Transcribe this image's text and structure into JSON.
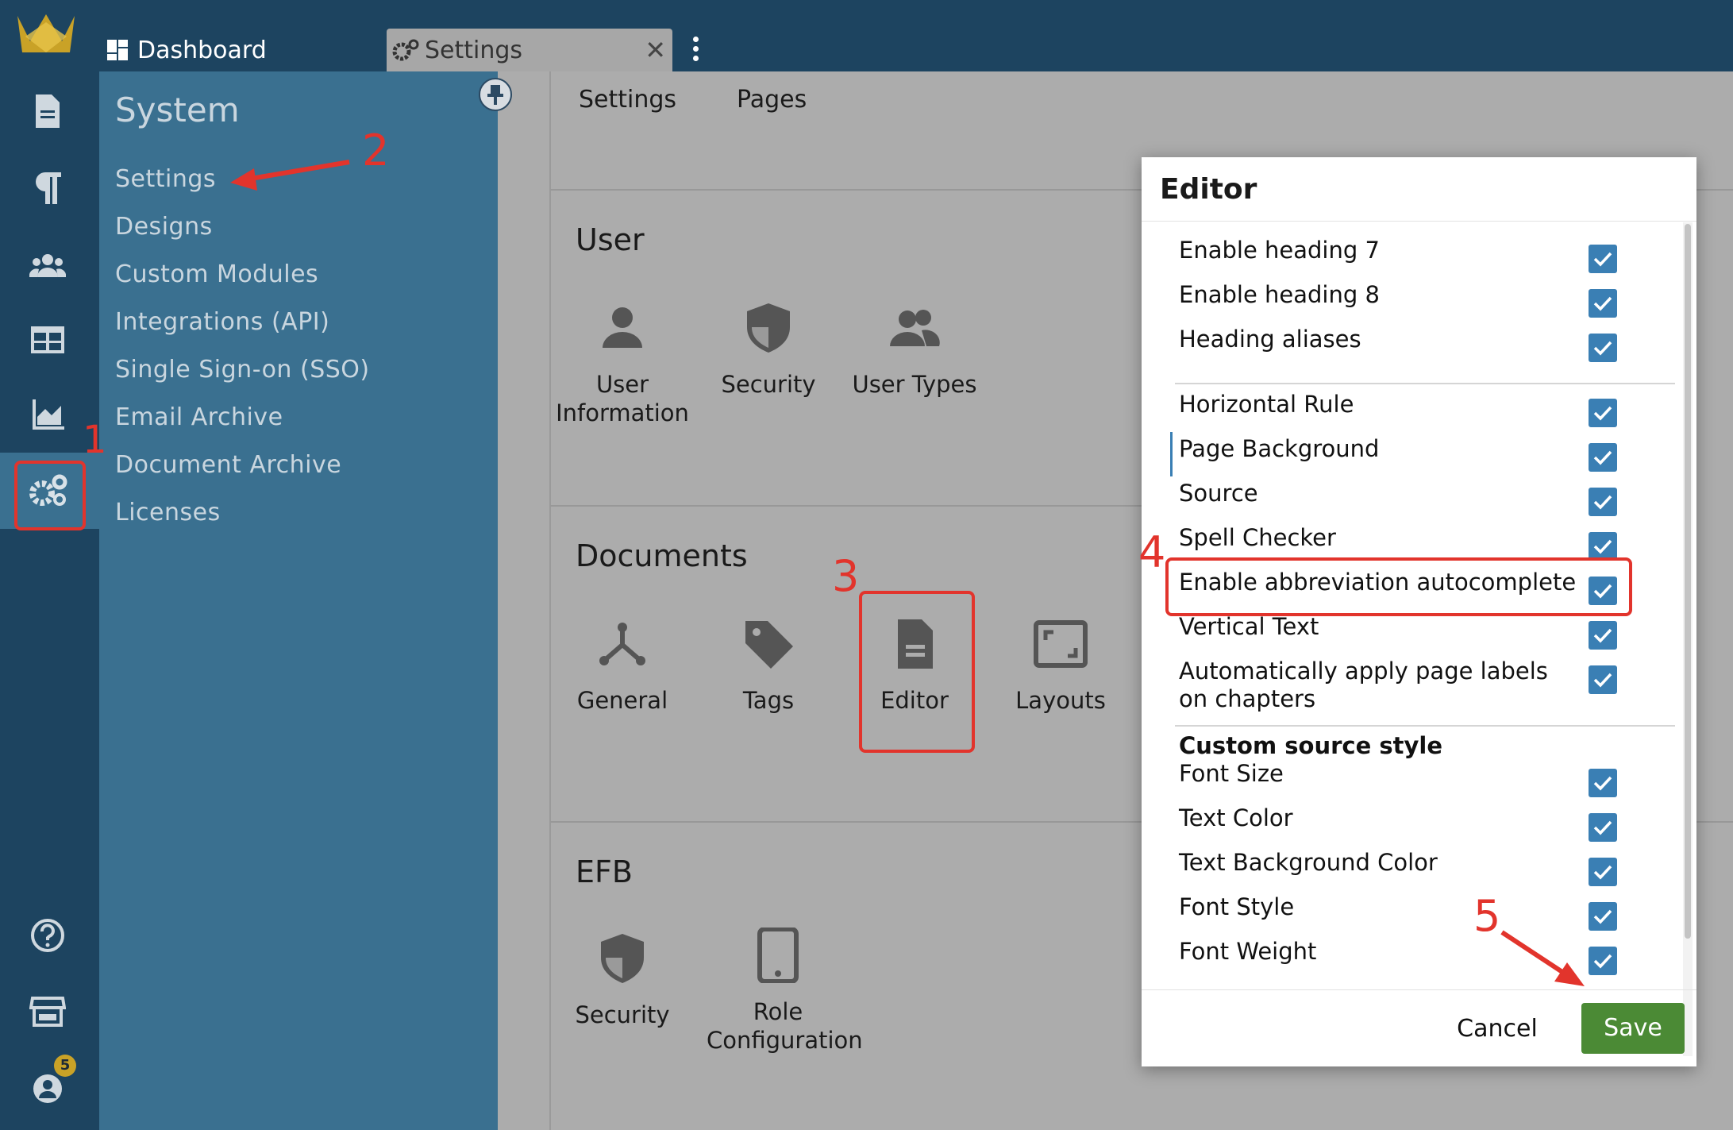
{
  "tabs": {
    "dashboard": "Dashboard",
    "settings": "Settings"
  },
  "sidebar": {
    "title": "System",
    "items": [
      "Settings",
      "Designs",
      "Custom Modules",
      "Integrations (API)",
      "Single Sign-on (SSO)",
      "Email Archive",
      "Document Archive",
      "Licenses"
    ]
  },
  "main": {
    "tabs": [
      "Settings",
      "Pages"
    ],
    "sections": [
      {
        "title": "User",
        "tiles": [
          "User Information",
          "Security",
          "User Types"
        ]
      },
      {
        "title": "Documents",
        "tiles": [
          "General",
          "Tags",
          "Editor",
          "Layouts"
        ]
      },
      {
        "title": "EFB",
        "tiles": [
          "Security",
          "Role Configuration"
        ]
      }
    ]
  },
  "badge": "5",
  "dialog": {
    "title": "Editor",
    "group1": [
      "Enable heading 7",
      "Enable heading 8",
      "Heading aliases"
    ],
    "group2": [
      "Horizontal Rule",
      "Page Background",
      "Source",
      "Spell Checker",
      "Enable abbreviation autocomplete",
      "Vertical Text",
      "Automatically apply page labels on chapters"
    ],
    "group3_title": "Custom source style",
    "group3": [
      "Font Size",
      "Text Color",
      "Text Background Color",
      "Font Style",
      "Font Weight"
    ],
    "cancel": "Cancel",
    "save": "Save"
  },
  "annotations": [
    "1",
    "2",
    "3",
    "4",
    "5"
  ],
  "colors": {
    "topbar": "#1d4460",
    "sidebar": "#3a7090",
    "accent": "#3a7fb4",
    "save": "#4b8a35",
    "annotation": "#e2342c"
  }
}
